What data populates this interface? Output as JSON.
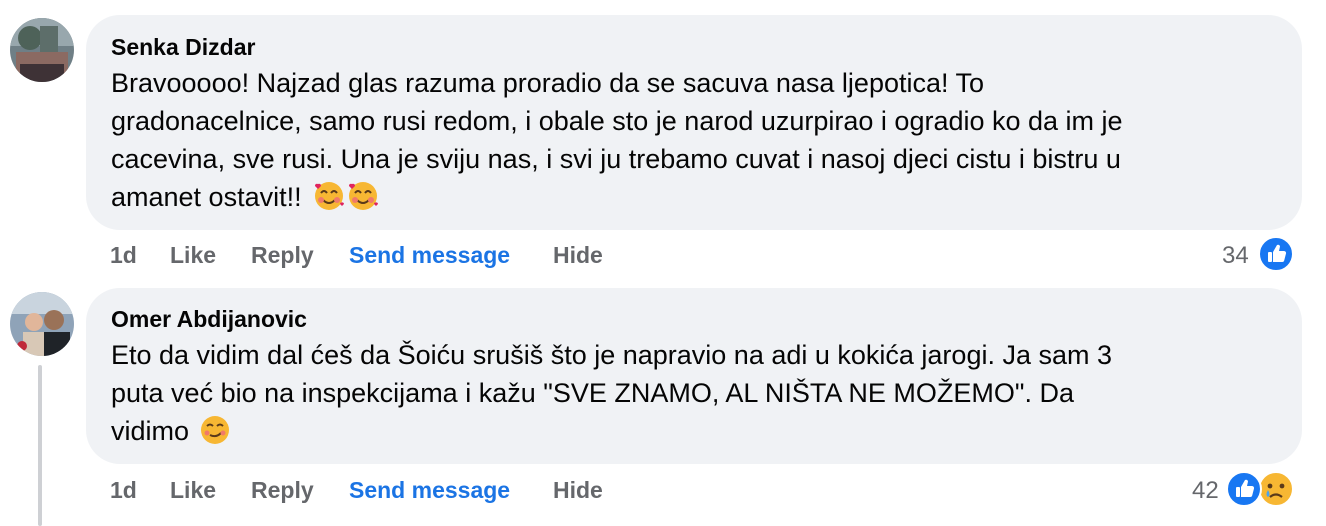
{
  "comments": [
    {
      "author": "Senka Dizdar",
      "lines": [
        "Bravooooo! Najzad glas razuma proradio da se sacuva nasa ljepotica! To",
        "gradonacelnice, samo rusi redom, i obale sto je narod uzurpirao i ogradio ko da im je",
        "cacevina, sve rusi. Una je sviju nas, i svi ju trebamo cuvat i nasoj djeci cistu i bistru u",
        "amanet ostavit!!"
      ],
      "emoji": [
        "smiling-face-with-hearts-icon",
        "smiling-face-with-hearts-icon"
      ],
      "time": "1d",
      "like": "Like",
      "reply": "Reply",
      "send_message": "Send message",
      "hide": "Hide",
      "reaction_count": "34",
      "reactions": [
        "like-icon"
      ]
    },
    {
      "author": "Omer Abdijanovic",
      "lines": [
        "Eto da vidim dal ćeš da Šoiću srušiš što je napravio na adi u kokića jarogi. Ja sam 3",
        "puta već bio na inspekcijama i kažu \"SVE ZNAMO, AL NIŠTA NE MOŽEMO\". Da",
        "vidimo"
      ],
      "emoji": [
        "smirking-face-icon"
      ],
      "time": "1d",
      "like": "Like",
      "reply": "Reply",
      "send_message": "Send message",
      "hide": "Hide",
      "reaction_count": "42",
      "reactions": [
        "like-icon",
        "sad-face-icon"
      ]
    }
  ],
  "colors": {
    "bubble": "#f0f2f5",
    "text": "#050505",
    "secondary": "#65676b",
    "link": "#1b74e4",
    "like_blue": "#1877f2"
  }
}
